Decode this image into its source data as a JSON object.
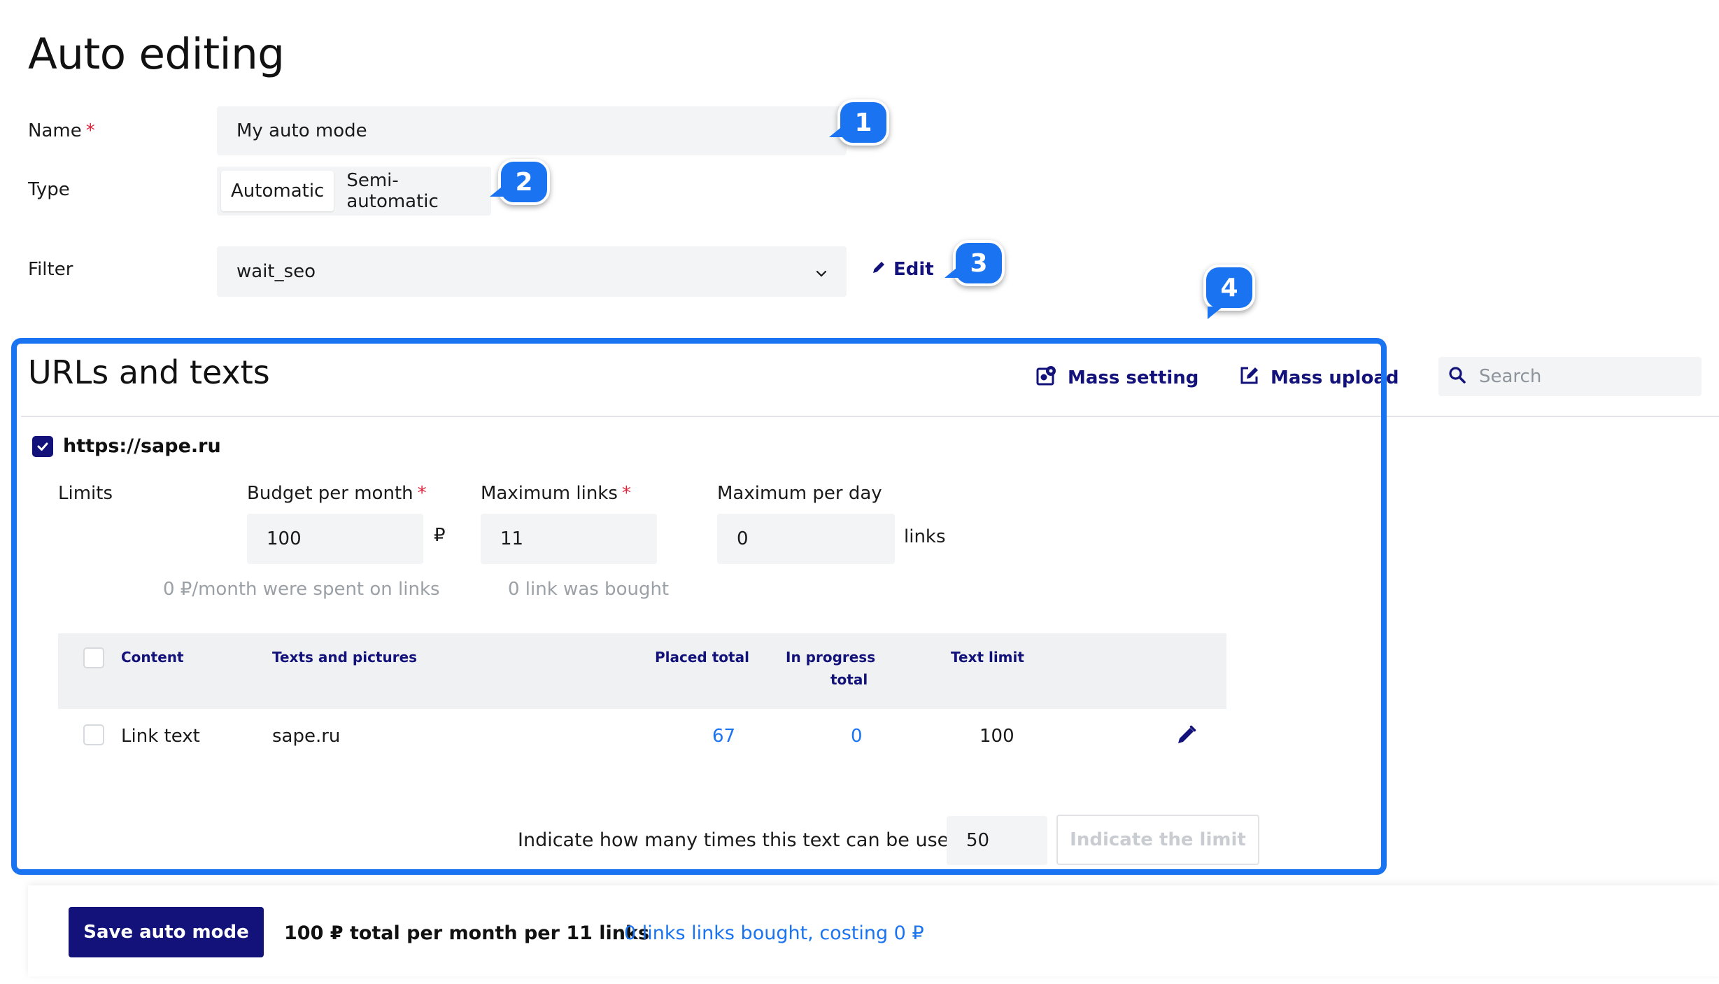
{
  "page": {
    "title": "Auto editing"
  },
  "form": {
    "name_label": "Name",
    "required_mark": "*",
    "name_value": "My auto mode",
    "type_label": "Type",
    "type_options": [
      "Automatic",
      "Semi-automatic"
    ],
    "type_selected": "Automatic",
    "filter_label": "Filter",
    "filter_value": "wait_seo",
    "edit_label": "Edit"
  },
  "callouts": [
    "1",
    "2",
    "3",
    "4"
  ],
  "section": {
    "title": "URLs and texts",
    "mass_setting_label": "Mass setting",
    "mass_upload_label": "Mass upload",
    "search_placeholder": "Search"
  },
  "site": {
    "url": "https://sape.ru",
    "checked": true,
    "limits_label": "Limits",
    "budget_label": "Budget per month",
    "budget_value": "100",
    "currency": "₽",
    "max_links_label": "Maximum links",
    "max_links_value": "11",
    "max_per_day_label": "Maximum per day",
    "max_per_day_value": "0",
    "per_day_unit": "links",
    "spent_hint": "0 ₽/month were spent on links",
    "bought_hint": "0 link was bought"
  },
  "table": {
    "headers": {
      "content": "Content",
      "texts": "Texts and pictures",
      "placed": "Placed total",
      "in_progress_1": "In progress",
      "in_progress_2": "total",
      "text_limit": "Text limit"
    },
    "rows": [
      {
        "content": "Link text",
        "texts": "sape.ru",
        "placed": "67",
        "in_progress": "0",
        "text_limit": "100"
      }
    ]
  },
  "limit_prompt": {
    "text": "Indicate how many times this text can be used",
    "value": "50",
    "button": "Indicate the limit"
  },
  "footer": {
    "save_label": "Save auto mode",
    "summary": "100 ₽ total per month per 11 links",
    "bought_link": "0 links links bought, costing 0 ₽"
  },
  "colors": {
    "navy": "#12127a",
    "accent_blue": "#1a73f1",
    "field_gray": "#f3f4f5",
    "required_red": "#e0243c"
  }
}
